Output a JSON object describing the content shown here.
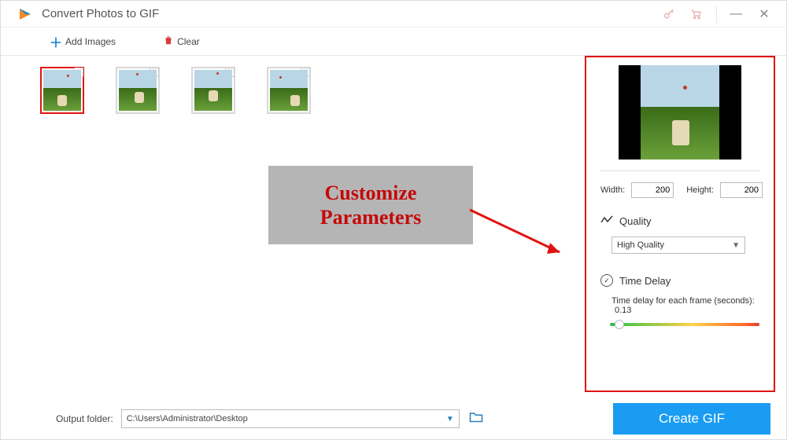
{
  "title": "Convert Photos to GIF",
  "toolbar": {
    "add_label": "Add Images",
    "clear_label": "Clear"
  },
  "thumbs": [
    "frame-1",
    "frame-2",
    "frame-3",
    "frame-4"
  ],
  "annotation": "Customize\nParameters",
  "panel": {
    "width_label": "Width:",
    "width_value": "200",
    "height_label": "Height:",
    "height_value": "200",
    "quality_label": "Quality",
    "quality_value": "High Quality",
    "timedelay_label": "Time Delay",
    "delay_caption": "Time delay for each frame (seconds):",
    "delay_value": "0.13"
  },
  "footer": {
    "output_label": "Output folder:",
    "output_path": "C:\\Users\\Administrator\\Desktop",
    "create_label": "Create GIF"
  }
}
